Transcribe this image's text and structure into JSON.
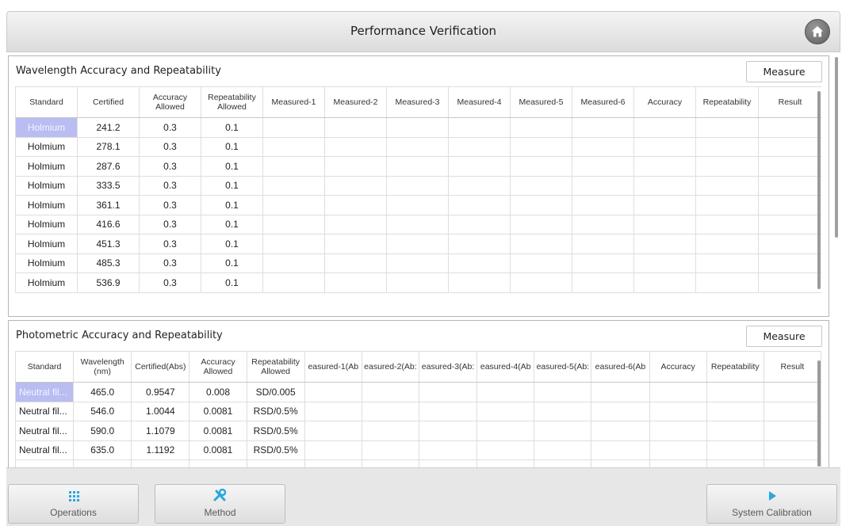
{
  "header": {
    "title": "Performance Verification"
  },
  "wavelength": {
    "title": "Wavelength Accuracy and Repeatability",
    "measure_label": "Measure",
    "columns": [
      "Standard",
      "Certified",
      "Accuracy Allowed",
      "Repeatability Allowed",
      "Measured-1",
      "Measured-2",
      "Measured-3",
      "Measured-4",
      "Measured-5",
      "Measured-6",
      "Accuracy",
      "Repeatability",
      "Result"
    ],
    "rows": [
      [
        "Holmium",
        "241.2",
        "0.3",
        "0.1",
        "",
        "",
        "",
        "",
        "",
        "",
        "",
        "",
        ""
      ],
      [
        "Holmium",
        "278.1",
        "0.3",
        "0.1",
        "",
        "",
        "",
        "",
        "",
        "",
        "",
        "",
        ""
      ],
      [
        "Holmium",
        "287.6",
        "0.3",
        "0.1",
        "",
        "",
        "",
        "",
        "",
        "",
        "",
        "",
        ""
      ],
      [
        "Holmium",
        "333.5",
        "0.3",
        "0.1",
        "",
        "",
        "",
        "",
        "",
        "",
        "",
        "",
        ""
      ],
      [
        "Holmium",
        "361.1",
        "0.3",
        "0.1",
        "",
        "",
        "",
        "",
        "",
        "",
        "",
        "",
        ""
      ],
      [
        "Holmium",
        "416.6",
        "0.3",
        "0.1",
        "",
        "",
        "",
        "",
        "",
        "",
        "",
        "",
        ""
      ],
      [
        "Holmium",
        "451.3",
        "0.3",
        "0.1",
        "",
        "",
        "",
        "",
        "",
        "",
        "",
        "",
        ""
      ],
      [
        "Holmium",
        "485.3",
        "0.3",
        "0.1",
        "",
        "",
        "",
        "",
        "",
        "",
        "",
        "",
        ""
      ],
      [
        "Holmium",
        "536.9",
        "0.3",
        "0.1",
        "",
        "",
        "",
        "",
        "",
        "",
        "",
        "",
        ""
      ]
    ]
  },
  "photometric": {
    "title": "Photometric Accuracy and Repeatability",
    "measure_label": "Measure",
    "columns": [
      "Standard",
      "Wavelength (nm)",
      "Certified(Abs)",
      "Accuracy Allowed",
      "Repeatability Allowed",
      "easured-1(Ab",
      "easured-2(Ab:",
      "easured-3(Ab:",
      "easured-4(Ab",
      "easured-5(Ab:",
      "easured-6(Ab",
      "Accuracy",
      "Repeatability",
      "Result"
    ],
    "rows": [
      [
        "Neutral fil...",
        "465.0",
        "0.9547",
        "0.008",
        "SD/0.005",
        "",
        "",
        "",
        "",
        "",
        "",
        "",
        "",
        ""
      ],
      [
        "Neutral fil...",
        "546.0",
        "1.0044",
        "0.0081",
        "RSD/0.5%",
        "",
        "",
        "",
        "",
        "",
        "",
        "",
        "",
        ""
      ],
      [
        "Neutral fil...",
        "590.0",
        "1.1079",
        "0.0081",
        "RSD/0.5%",
        "",
        "",
        "",
        "",
        "",
        "",
        "",
        "",
        ""
      ],
      [
        "Neutral fil...",
        "635.0",
        "1.1192",
        "0.0081",
        "RSD/0.5%",
        "",
        "",
        "",
        "",
        "",
        "",
        "",
        "",
        ""
      ],
      [
        "",
        "",
        "",
        "",
        "",
        "",
        "",
        "",
        "",
        "",
        "",
        "",
        "",
        ""
      ]
    ]
  },
  "bottom": {
    "operations": "Operations",
    "method": "Method",
    "system_calibration": "System Calibration"
  },
  "colors": {
    "selection": "#b9bdf2",
    "icon_accent": "#29a8dd"
  }
}
